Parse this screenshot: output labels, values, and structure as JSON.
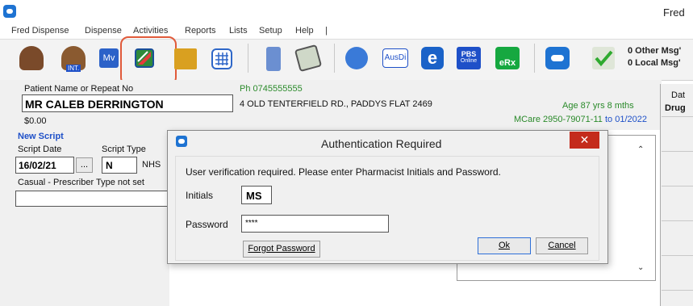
{
  "window": {
    "title": "Fred"
  },
  "menu": [
    "Fred Dispense",
    "Dispense",
    "Activities",
    "Reports",
    "Lists",
    "Setup",
    "Help",
    "|"
  ],
  "toolbar": {
    "int_label": "INT.",
    "mv_label": "Mv",
    "ausdi_label": "AusDi",
    "pbs_label": "PBS",
    "pbs_sub": "Online",
    "erx_label": "eRx",
    "messages": [
      "0 Other Msg'",
      "0 Local Msg'"
    ]
  },
  "patient": {
    "name_label": "Patient Name or Repeat No",
    "name": "MR CALEB DERRINGTON",
    "amount": "$0.00",
    "phone": "Ph 0745555555",
    "address": "4 OLD TENTERFIELD RD., PADDYS FLAT 2469",
    "age": "Age 87 yrs 8 mths",
    "mcare": "MCare 2950-79071-11",
    "mcare_to": "to 01/2022"
  },
  "script": {
    "heading": "New Script",
    "date_label": "Script Date",
    "date": "16/02/21",
    "ellipsis": "...",
    "type_label": "Script Type",
    "type": "N",
    "type_desc": "NHS",
    "prescriber": "Casual - Prescriber Type not set"
  },
  "right_col": {
    "header": "Dat",
    "sub": "Drug"
  },
  "dialog": {
    "title": "Authentication Required",
    "close": "✕",
    "message": "User verification required. Please enter Pharmacist Initials and Password.",
    "initials_label": "Initials",
    "initials": "MS",
    "password_label": "Password",
    "password": "****",
    "forgot": "Forgot Password",
    "ok": "Ok",
    "cancel": "Cancel"
  },
  "colors": {
    "accent": "#1e73d2",
    "highlight": "#e05a3a",
    "close": "#c42b1c",
    "age": "#2a8a2a"
  }
}
